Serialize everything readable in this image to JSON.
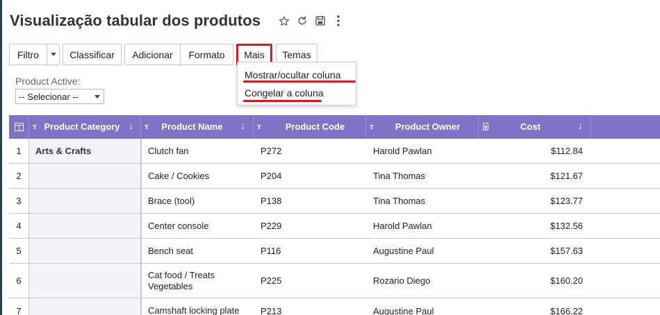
{
  "page": {
    "title": "Visualização tabular dos produtos"
  },
  "title_icons": [
    "star-icon",
    "refresh-icon",
    "save-icon",
    "more-vert-icon"
  ],
  "toolbar": {
    "filter": "Filtro",
    "sort": "Classificar",
    "add": "Adicionar",
    "format": "Formato",
    "more": "Mais",
    "themes": "Temas"
  },
  "more_menu": {
    "items": [
      "Mostrar/ocultar coluna",
      "Congelar a coluna"
    ]
  },
  "filter_field": {
    "label": "Product Active:",
    "value": "-- Selecionar --"
  },
  "grid": {
    "columns": [
      {
        "label": "Product Category",
        "sort": "↓"
      },
      {
        "label": "Product Name",
        "sort": "↓"
      },
      {
        "label": "Product Code",
        "sort": ""
      },
      {
        "label": "Product Owner",
        "sort": ""
      },
      {
        "label": "Cost",
        "sort": "↓"
      }
    ],
    "category_value": "Arts & Crafts",
    "rows": [
      {
        "num": "1",
        "name": "Clutch fan",
        "code": "P272",
        "owner": "Harold Pawlan",
        "cost": "$112.84"
      },
      {
        "num": "2",
        "name": "Cake / Cookies",
        "code": "P204",
        "owner": "Tina Thomas",
        "cost": "$121.67"
      },
      {
        "num": "3",
        "name": "Brace (tool)",
        "code": "P138",
        "owner": "Tina Thomas",
        "cost": "$123.77"
      },
      {
        "num": "4",
        "name": "Center console",
        "code": "P229",
        "owner": "Harold Pawlan",
        "cost": "$132.56"
      },
      {
        "num": "5",
        "name": "Bench seat",
        "code": "P116",
        "owner": "Augustine Paul",
        "cost": "$157.63"
      },
      {
        "num": "6",
        "name": "Cat food / Treats Vegetables",
        "code": "P225",
        "owner": "Rozario Diego",
        "cost": "$160.20"
      },
      {
        "num": "7",
        "name": "Camshaft locking plate",
        "code": "P213",
        "owner": "Augustine Paul",
        "cost": "$166.22"
      }
    ]
  },
  "colors": {
    "header": "#8072c7",
    "highlight": "#e0161f"
  }
}
